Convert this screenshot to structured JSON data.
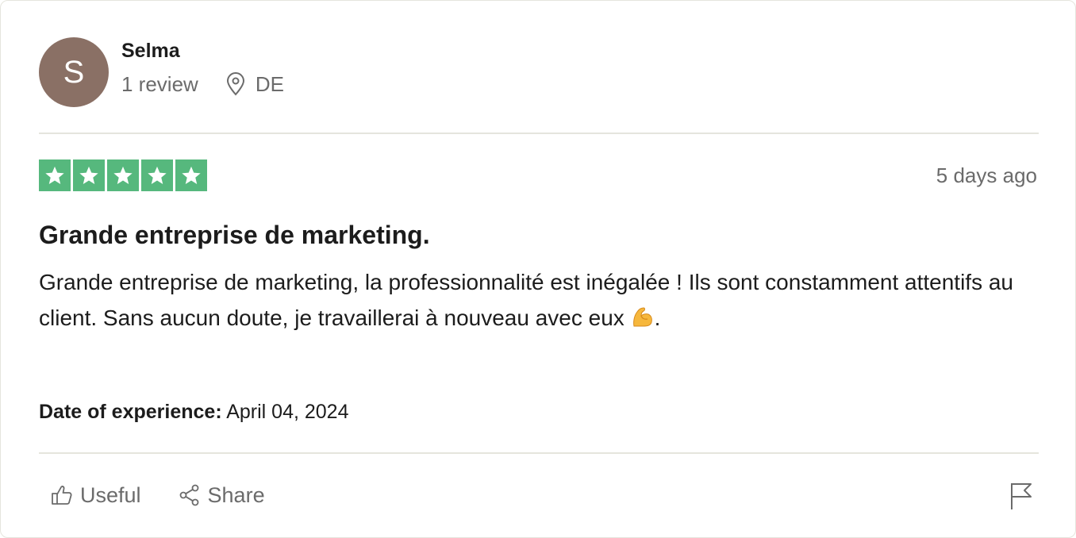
{
  "consumer": {
    "avatar_initial": "S",
    "avatar_color": "#8a7065",
    "name": "Selma",
    "review_count": "1 review",
    "country": "DE"
  },
  "review": {
    "rating": 5,
    "max_rating": 5,
    "star_color": "#56b87d",
    "date_ago": "5 days ago",
    "title": "Grande entreprise de marketing.",
    "body": "Grande entreprise de marketing, la professionnalité est inégalée ! Ils sont constamment attentifs au client. Sans aucun doute, je travaillerai à nouveau avec eux ",
    "body_emoji": "flexed-biceps-icon",
    "body_end": ".",
    "experience_label": "Date of experience:",
    "experience_date": "April 04, 2024"
  },
  "actions": {
    "useful_label": "Useful",
    "useful_icon": "thumbs-up-icon",
    "share_label": "Share",
    "share_icon": "share-icon",
    "flag_icon": "flag-icon"
  }
}
